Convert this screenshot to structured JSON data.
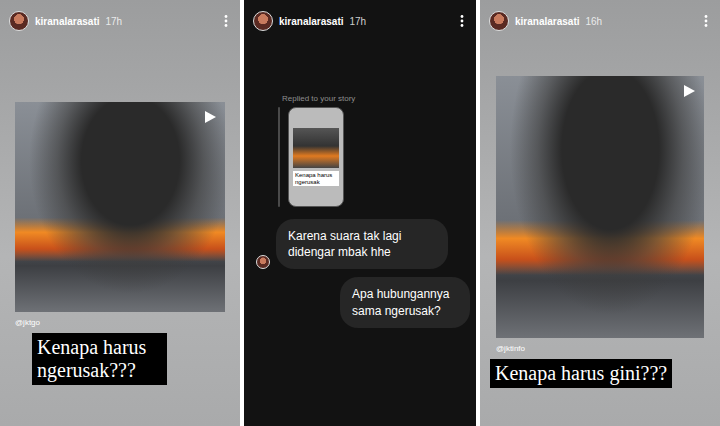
{
  "stories": [
    {
      "kind": "photo",
      "username": "kiranalarasati",
      "time": "17h",
      "source": "@jktgo",
      "caption": "Kenapa harus ngerusak???"
    },
    {
      "kind": "chat",
      "username": "kiranalarasati",
      "time": "17h",
      "reply_label": "Replied to your story",
      "thumbnail_caption": "Kenapa harus ngerusak",
      "messages": [
        {
          "text": "Karena suara tak lagi didengar mbak hhe",
          "from_me": false
        },
        {
          "text": "Apa hubungannya sama ngerusak?",
          "from_me": true
        }
      ]
    },
    {
      "kind": "photo",
      "username": "kiranalarasati",
      "time": "16h",
      "source": "@jktinfo",
      "caption": "Kenapa harus gini???"
    }
  ]
}
